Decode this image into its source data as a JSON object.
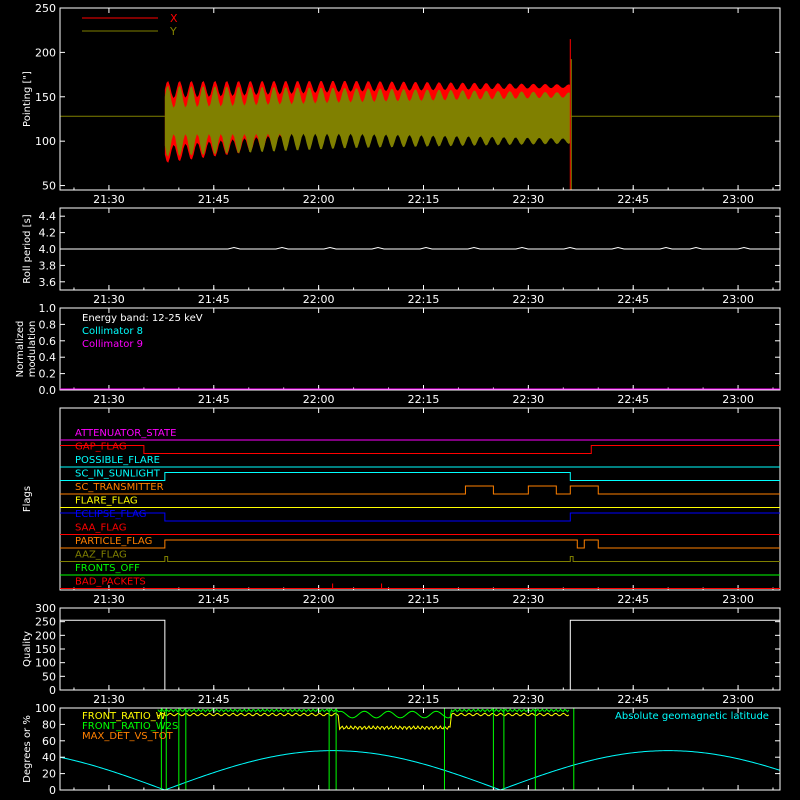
{
  "chart_data": [
    {
      "id": "pointing",
      "type": "line",
      "ylabel": "Pointing [\"]",
      "ylim": [
        45,
        250
      ],
      "yticks": [
        50,
        100,
        150,
        200,
        250
      ],
      "xticks": [
        "21:30",
        "21:45",
        "22:00",
        "22:15",
        "22:30",
        "22:45",
        "23:00"
      ],
      "xlim_minutes": [
        1283,
        1386
      ],
      "series": [
        {
          "name": "X",
          "color": "#ff0000",
          "center": 128,
          "band_start": [
            85,
            158
          ],
          "band_end": [
            108,
            162
          ],
          "data_range_minutes": [
            1298,
            1356
          ]
        },
        {
          "name": "Y",
          "color": "#808000",
          "center": 128,
          "band_start": [
            95,
            150
          ],
          "band_end": [
            100,
            152
          ],
          "data_range_minutes": [
            1298,
            1356
          ]
        }
      ],
      "spike": {
        "minute": 1356,
        "value": 215
      }
    },
    {
      "id": "roll",
      "type": "line",
      "ylabel": "Roll period [s]",
      "ylim": [
        3.5,
        4.5
      ],
      "yticks": [
        "3.6",
        "3.8",
        "4.0",
        "4.2",
        "4.4"
      ],
      "xticks": [
        "21:30",
        "21:45",
        "22:00",
        "22:15",
        "22:30",
        "22:45",
        "23:00"
      ],
      "series": [
        {
          "name": "",
          "color": "#ffffff",
          "value": 4.0
        }
      ]
    },
    {
      "id": "modulation",
      "type": "line",
      "ylabel": "Normalized modulation",
      "ylim": [
        0.0,
        1.0
      ],
      "yticks": [
        "0.0",
        "0.2",
        "0.4",
        "0.6",
        "0.8",
        "1.0"
      ],
      "xticks": [
        "21:30",
        "21:45",
        "22:00",
        "22:15",
        "22:30",
        "22:45",
        "23:00"
      ],
      "legend": [
        {
          "label": "Energy band: 12-25 keV",
          "color": "#ffffff"
        },
        {
          "label": "Collimator 8",
          "color": "#00ffff"
        },
        {
          "label": "Collimator 9",
          "color": "#ff00ff"
        }
      ],
      "series": [
        {
          "name": "Collimator 9",
          "color": "#ff00ff",
          "value": 0.0
        }
      ]
    },
    {
      "id": "flags",
      "type": "line",
      "ylabel": "Flags",
      "xticks": [
        "21:30",
        "21:45",
        "22:00",
        "22:15",
        "22:30",
        "22:45",
        "23:00"
      ],
      "flags": [
        {
          "name": "ATTENUATOR_STATE",
          "color": "#ff00ff"
        },
        {
          "name": "GAP_FLAG",
          "color": "#ff0000"
        },
        {
          "name": "POSSIBLE_FLARE",
          "color": "#00ffff"
        },
        {
          "name": "SC_IN_SUNLIGHT",
          "color": "#00ffff"
        },
        {
          "name": "SC_TRANSMITTER",
          "color": "#ff8000"
        },
        {
          "name": "FLARE_FLAG",
          "color": "#ffff00"
        },
        {
          "name": "ECLIPSE_FLAG",
          "color": "#0000ff"
        },
        {
          "name": "SAA_FLAG",
          "color": "#ff0000"
        },
        {
          "name": "PARTICLE_FLAG",
          "color": "#ff8000"
        },
        {
          "name": "AAZ_FLAG",
          "color": "#808000"
        },
        {
          "name": "FRONTS_OFF",
          "color": "#00ff00"
        },
        {
          "name": "BAD_PACKETS",
          "color": "#ff0000"
        }
      ]
    },
    {
      "id": "quality",
      "type": "line",
      "ylabel": "Quality",
      "ylim": [
        0,
        300
      ],
      "yticks": [
        "0",
        "50",
        "100",
        "150",
        "200",
        "250",
        "300"
      ],
      "xticks": [
        "21:30",
        "21:45",
        "22:00",
        "22:15",
        "22:30",
        "22:45",
        "23:00"
      ],
      "series": [
        {
          "name": "",
          "color": "#ffffff",
          "high": 255,
          "low": 0,
          "low_range_minutes": [
            1298,
            1356
          ]
        }
      ]
    },
    {
      "id": "latitude",
      "type": "line",
      "ylabel": "Degrees or %",
      "ylim": [
        0,
        100
      ],
      "yticks": [
        "0",
        "20",
        "40",
        "60",
        "80",
        "100"
      ],
      "legend": [
        {
          "label": "FRONT_RATIO_W",
          "color": "#ffff00"
        },
        {
          "label": "FRONT_RATIO_W2S",
          "color": "#00ff00"
        },
        {
          "label": "MAX_DET_VS_TOT",
          "color": "#ff8000"
        },
        {
          "label": "Absolute geomagnetic latitude",
          "color": "#00ffff"
        }
      ],
      "series": [
        {
          "name": "Absolute geomagnetic latitude",
          "color": "#00ffff",
          "max": 48,
          "min": 0
        },
        {
          "name": "FRONT_RATIO_W",
          "color": "#ffff00",
          "level": 92
        },
        {
          "name": "FRONT_RATIO_W2S",
          "color": "#00ff00",
          "level": 97
        }
      ]
    }
  ]
}
